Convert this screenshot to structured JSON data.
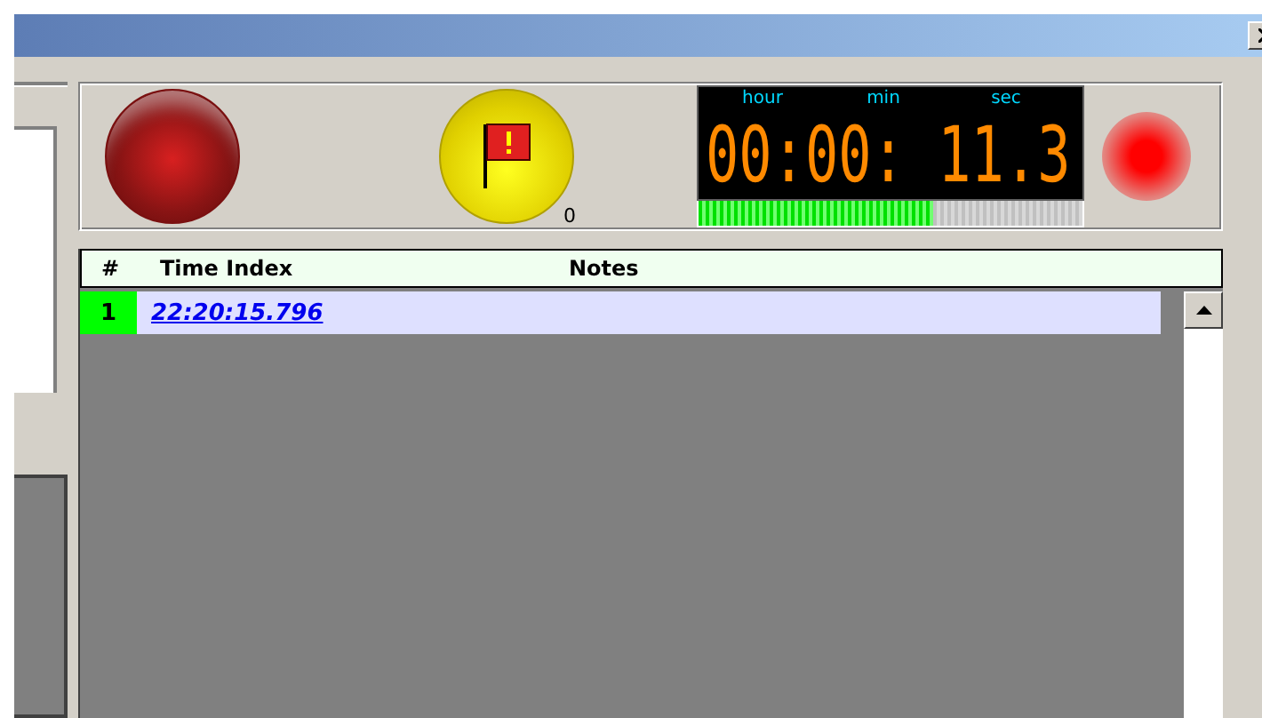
{
  "controls": {
    "flag_count": "0",
    "recording": true
  },
  "clock": {
    "labels": [
      "hour",
      "min",
      "sec"
    ],
    "display": "00:00: 11.3",
    "level": 0.61
  },
  "table": {
    "columns": [
      "#",
      "Time Index",
      "Notes"
    ],
    "rows": [
      {
        "number": "1",
        "time_index": "22:20:15.796",
        "selected": true
      }
    ]
  }
}
